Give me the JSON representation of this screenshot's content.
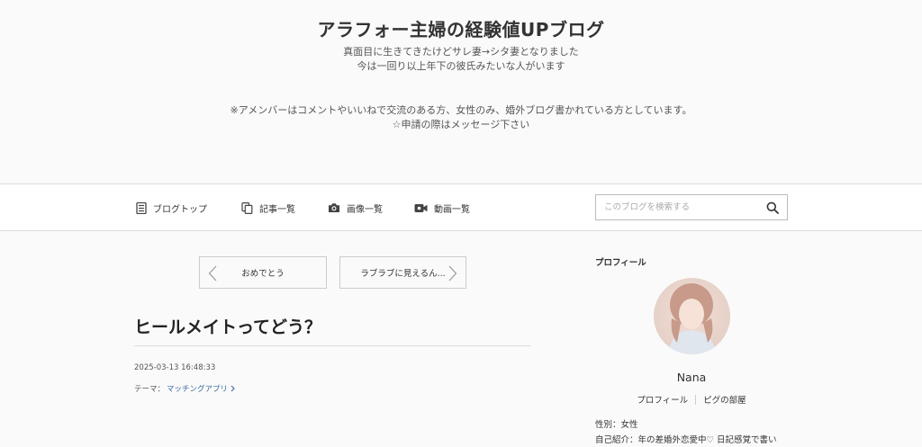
{
  "header": {
    "title": "アラフォー主婦の経験値UPブログ",
    "desc_line1": "真面目に生きてきたけどサレ妻→シタ妻となりました",
    "desc_line2": "今は一回り以上年下の彼氏みたいな人がいます",
    "desc_line3": "※アメンバーはコメントやいいねで交流のある方、女性のみ、婚外ブログ書かれている方としています。",
    "desc_line4": "☆申請の際はメッセージ下さい"
  },
  "nav": {
    "items": [
      {
        "label": "ブログトップ",
        "icon": "document-icon"
      },
      {
        "label": "記事一覧",
        "icon": "copy-icon"
      },
      {
        "label": "画像一覧",
        "icon": "camera-icon"
      },
      {
        "label": "動画一覧",
        "icon": "video-icon"
      }
    ],
    "search_placeholder": "このブログを検索する"
  },
  "pager": {
    "prev_label": "おめでとう",
    "next_label": "ラブラブに見えるん..."
  },
  "article": {
    "title": "ヒールメイトってどう？",
    "timestamp": "2025-03-13 16:48:33",
    "theme_prefix": "テーマ：",
    "theme_link": "マッチングアプリ"
  },
  "sidebar": {
    "heading": "プロフィール",
    "name": "Nana",
    "link_profile": "プロフィール",
    "link_room": "ピグの部屋",
    "gender": "性別：女性",
    "intro": "自己紹介：年の差婚外恋愛中♡ 日記感覚で書い"
  },
  "colors": {
    "background": "#fafafa",
    "link": "#3b6aa0",
    "border": "#cccccc"
  }
}
